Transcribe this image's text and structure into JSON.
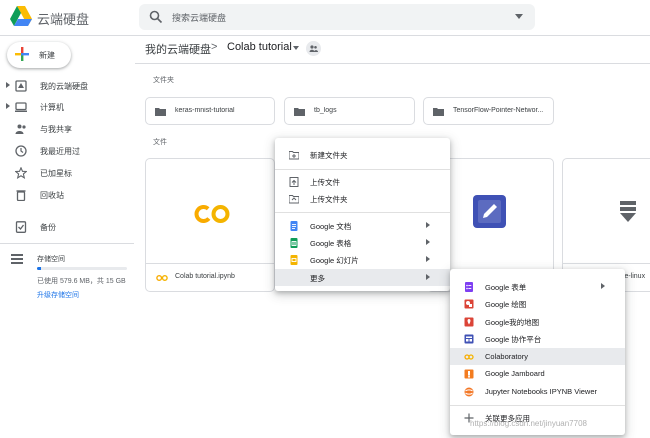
{
  "header": {
    "app_title": "云端硬盘",
    "search_placeholder": "搜索云端硬盘"
  },
  "sidebar": {
    "new_label": "新建",
    "items": [
      {
        "label": "我的云端硬盘",
        "icon": "my-drive-icon"
      },
      {
        "label": "计算机",
        "icon": "computer-icon"
      },
      {
        "label": "与我共享",
        "icon": "people-icon"
      },
      {
        "label": "我最近用过",
        "icon": "clock-icon"
      },
      {
        "label": "已加星标",
        "icon": "star-icon"
      },
      {
        "label": "回收站",
        "icon": "trash-icon"
      },
      {
        "label": "备份",
        "icon": "backup-icon"
      }
    ],
    "storage": {
      "title": "存储空间",
      "used_text": "已使用 579.6 MB，共 15 GB",
      "used_fraction": 0.04,
      "upgrade": "升级存储空间"
    }
  },
  "breadcrumb": {
    "root": "我的云端硬盘",
    "separator": ">",
    "current": "Colab tutorial"
  },
  "main": {
    "folders_label": "文件夹",
    "files_label": "文件",
    "folders": [
      {
        "name": "keras-mnist-tutorial"
      },
      {
        "name": "tb_logs"
      },
      {
        "name": "TensorFlow-Pointer-Networ..."
      }
    ],
    "files": [
      {
        "name": "Colab tutorial.ipynb",
        "thumb": "CO"
      },
      {
        "name": "ple-linux"
      }
    ]
  },
  "context_menu": {
    "items": [
      {
        "label": "新建文件夹",
        "icon": "new-folder-icon"
      },
      {
        "label": "上传文件",
        "icon": "upload-file-icon"
      },
      {
        "label": "上传文件夹",
        "icon": "upload-folder-icon"
      },
      {
        "label": "Google 文档",
        "icon": "google-docs-icon",
        "color": "#4285f4"
      },
      {
        "label": "Google 表格",
        "icon": "google-sheets-icon",
        "color": "#0f9d58"
      },
      {
        "label": "Google 幻灯片",
        "icon": "google-slides-icon",
        "color": "#f4b400"
      },
      {
        "label": "更多",
        "icon": ""
      }
    ]
  },
  "submenu": {
    "items": [
      {
        "label": "Google 表单",
        "icon": "google-forms-icon",
        "color": "#7e3ff2"
      },
      {
        "label": "Google 绘图",
        "icon": "google-drawings-icon",
        "color": "#db4437"
      },
      {
        "label": "Google我的地图",
        "icon": "google-my-maps-icon",
        "color": "#db4437"
      },
      {
        "label": "Google 协作平台",
        "icon": "google-sites-icon",
        "color": "#3f51b5"
      },
      {
        "label": "Colaboratory",
        "icon": "colab-icon",
        "color": "#f9ab00"
      },
      {
        "label": "Google Jamboard",
        "icon": "jamboard-icon",
        "color": "#f37c20"
      },
      {
        "label": "Jupyter Notebooks IPYNB Viewer",
        "icon": "jupyter-icon",
        "color": "#f37726"
      },
      {
        "label": "关联更多应用",
        "icon": "plus-icon"
      }
    ]
  },
  "watermark": "https://blog.csdn.net/jinyuan7708",
  "colors": {
    "accent": "#1a73e8",
    "colab_orange": "#f9ab00",
    "colab_yellow": "#f4b400"
  }
}
